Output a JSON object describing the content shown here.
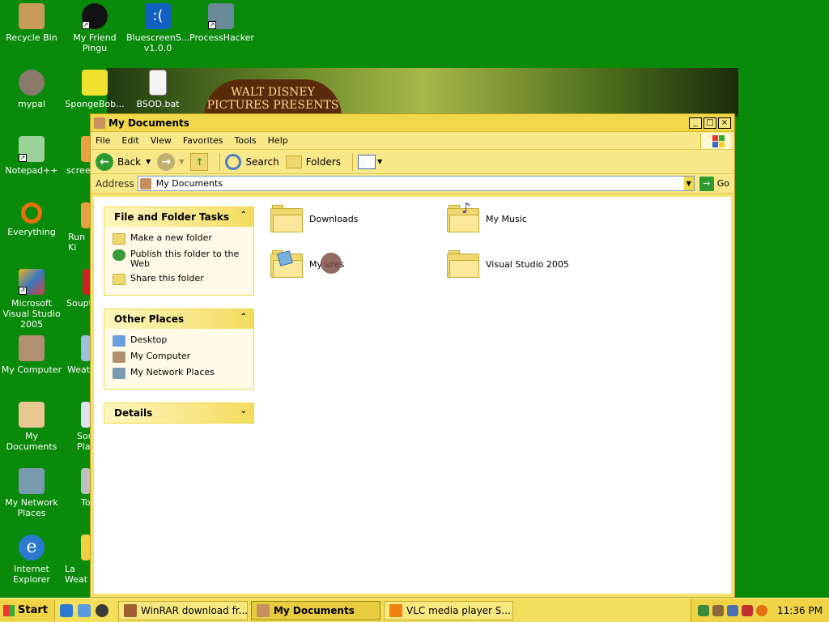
{
  "desktop": {
    "icons": [
      {
        "label": "Recycle Bin",
        "icon": "recycle-bin-icon"
      },
      {
        "label": "My Friend Pingu",
        "icon": "pingu-icon"
      },
      {
        "label": "BluescreenS... v1.0.0",
        "icon": "bluescreen-icon"
      },
      {
        "label": "ProcessHacker",
        "icon": "processhacker-icon"
      },
      {
        "label": "mypal",
        "icon": "mypal-icon"
      },
      {
        "label": "SpongeBob...",
        "icon": "spongebob-icon"
      },
      {
        "label": "BSOD.bat",
        "icon": "batch-file-icon"
      },
      {
        "label": "Notepad++",
        "icon": "notepadpp-icon"
      },
      {
        "label": "scree",
        "icon": "screenshot-icon"
      },
      {
        "label": "Everything",
        "icon": "everything-icon"
      },
      {
        "label": "Run Ki",
        "icon": "run-icon"
      },
      {
        "label": "Microsoft Visual Studio 2005",
        "icon": "visual-studio-icon"
      },
      {
        "label": "Soupt",
        "icon": "soup-icon"
      },
      {
        "label": "My Computer",
        "icon": "my-computer-icon"
      },
      {
        "label": "Weat",
        "icon": "weather-icon"
      },
      {
        "label": "My Documents",
        "icon": "my-documents-icon"
      },
      {
        "label": "Sou Pla",
        "icon": "sound-icon"
      },
      {
        "label": "My Network Places",
        "icon": "network-places-icon"
      },
      {
        "label": "To",
        "icon": "tool-icon"
      },
      {
        "label": "Internet Explorer",
        "icon": "ie-icon"
      },
      {
        "label": "La Weat",
        "icon": "weather2-icon"
      }
    ],
    "wallpaper_text": "WALT DISNEY PICTURES PRESENTS"
  },
  "window": {
    "title": "My Documents",
    "menu": [
      "File",
      "Edit",
      "View",
      "Favorites",
      "Tools",
      "Help"
    ],
    "toolbar": {
      "back": "Back",
      "search": "Search",
      "folders": "Folders"
    },
    "address": {
      "label": "Address",
      "value": "My Documents",
      "go": "Go"
    },
    "file_tasks": {
      "title": "File and Folder Tasks",
      "items": [
        "Make a new folder",
        "Publish this folder to the Web",
        "Share this folder"
      ]
    },
    "other_places": {
      "title": "Other Places",
      "items": [
        "Desktop",
        "My Computer",
        "My Network Places"
      ]
    },
    "details": {
      "title": "Details"
    },
    "files": [
      "Downloads",
      "My Music",
      "My Pictures",
      "Visual Studio 2005"
    ],
    "files_display": [
      "Downloads",
      "My Music",
      "My      ures",
      "Visual Studio 2005"
    ]
  },
  "taskbar": {
    "start": "Start",
    "tasks": [
      "WinRAR download fr...",
      "My Documents",
      "VLC media player S..."
    ],
    "clock": "11:36 PM"
  },
  "colors": {
    "desktop": "#0a8a0a",
    "window_frame": "#f0d84a",
    "taskbar": "#f3df5c"
  }
}
